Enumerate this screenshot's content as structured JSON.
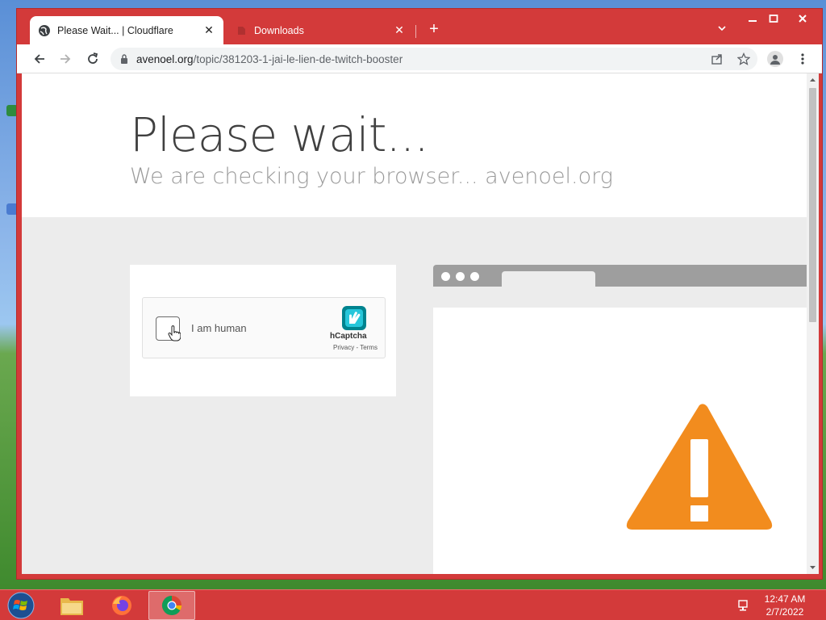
{
  "browser": {
    "tabs": [
      {
        "label": "Please Wait... | Cloudflare",
        "active": true
      },
      {
        "label": "Downloads",
        "active": false
      }
    ],
    "url_host": "avenoel.org",
    "url_path": "/topic/381203-1-jai-le-lien-de-twitch-booster"
  },
  "page": {
    "heading": "Please wait...",
    "subheading": "We are checking your browser... avenoel.org"
  },
  "captcha": {
    "label": "I am human",
    "brand": "hCaptcha",
    "links": "Privacy - Terms"
  },
  "taskbar": {
    "time": "12:47 AM",
    "date": "2/7/2022"
  },
  "colors": {
    "chrome_frame": "#d33a3a",
    "warning_orange": "#f28c1e"
  },
  "icons": [
    "windows-start-icon",
    "file-explorer-icon",
    "firefox-icon",
    "chrome-icon",
    "network-icon",
    "warning-icon",
    "hcaptcha-logo-icon"
  ]
}
